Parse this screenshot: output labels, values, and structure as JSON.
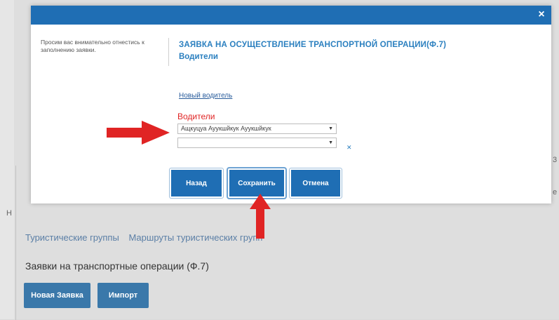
{
  "background": {
    "links": [
      "Туристические группы",
      "Маршруты туристических групп"
    ],
    "section_title": "Заявки на транспортные операции (Ф.7)",
    "new_request_button": "Новая Заявка",
    "import_button": "Импорт"
  },
  "modal": {
    "close_label": "×",
    "note": "Просим вас внимательно отнестись к заполнению заявки.",
    "title_line1": "ЗАЯВКА НА ОСУЩЕСТВЛЕНИЕ ТРАНСПОРТНОЙ ОПЕРАЦИИ(Ф.7)",
    "title_line2": "Водители",
    "new_driver_link": "Новый водитель",
    "drivers_label": "Водители",
    "driver_select_1": "Ащкуцуа Ауукшйкук Ауукшйкук",
    "driver_select_2": "",
    "buttons": {
      "back": "Назад",
      "save": "Сохранить",
      "cancel": "Отмена"
    }
  },
  "colors": {
    "header": "#1f6eb4",
    "title": "#2a7fbf",
    "drivers_label": "#e02424",
    "arrow": "#e02424",
    "button": "#1f6eb4"
  }
}
